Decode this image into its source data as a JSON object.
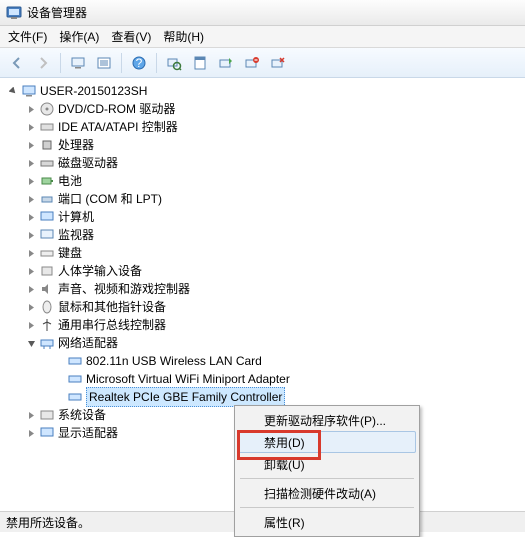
{
  "title": "设备管理器",
  "menus": [
    "文件(F)",
    "操作(A)",
    "查看(V)",
    "帮助(H)"
  ],
  "toolbar_icons": [
    "back-icon",
    "fwd-icon",
    "computer-icon",
    "folder-icon",
    "help-icon",
    "scan-icon",
    "prop-icon",
    "disable-icon",
    "uninstall-icon"
  ],
  "root": "USER-20150123SH",
  "categories": [
    "DVD/CD-ROM 驱动器",
    "IDE ATA/ATAPI 控制器",
    "处理器",
    "磁盘驱动器",
    "电池",
    "端口 (COM 和 LPT)",
    "计算机",
    "监视器",
    "键盘",
    "人体学输入设备",
    "声音、视频和游戏控制器",
    "鼠标和其他指针设备",
    "通用串行总线控制器"
  ],
  "network_label": "网络适配器",
  "network_children": [
    "802.11n USB Wireless LAN Card",
    "Microsoft Virtual WiFi Miniport Adapter",
    "Realtek PCIe GBE Family Controller"
  ],
  "tail_categories": [
    "系统设备",
    "显示适配器"
  ],
  "context_menu": {
    "update": "更新驱动程序软件(P)...",
    "disable": "禁用(D)",
    "uninstall": "卸载(U)",
    "scan": "扫描检测硬件改动(A)",
    "properties": "属性(R)"
  },
  "status": "禁用所选设备。"
}
